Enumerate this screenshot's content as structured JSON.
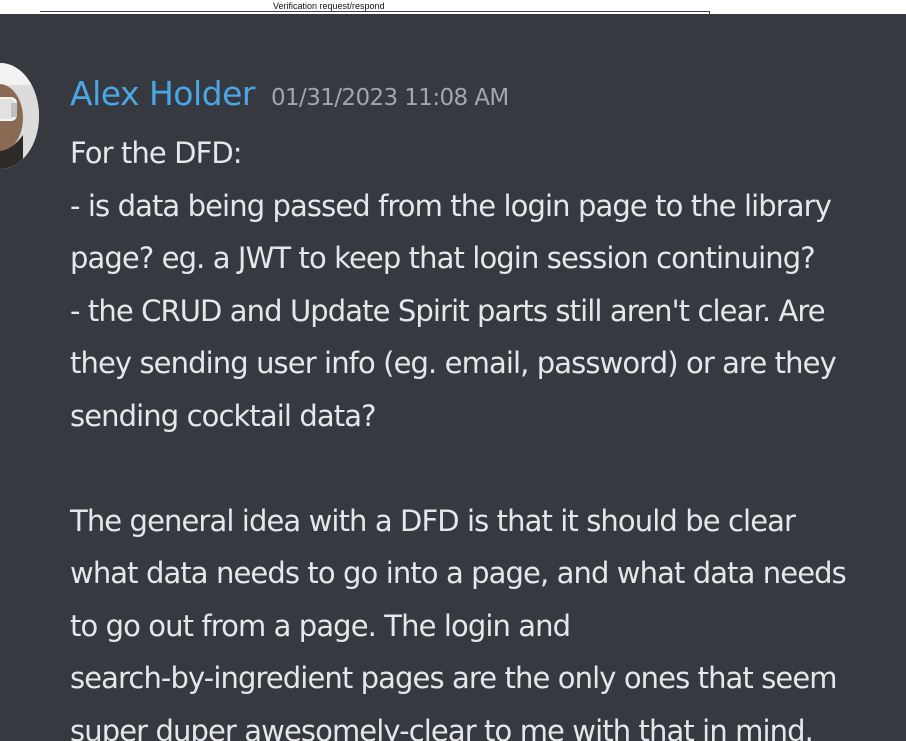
{
  "header_strip": {
    "caption": "Verification request/respond"
  },
  "message": {
    "author": "Alex Holder",
    "timestamp": "01/31/2023 11:08 AM",
    "lines": [
      "For the DFD:",
      "- is data being passed from the login page to the library",
      "page? eg. a JWT to keep that login session continuing?",
      "- the CRUD and Update Spirit parts still aren't clear. Are",
      "they sending user info (eg. email, password) or are they",
      "sending cocktail data?",
      "",
      "The general idea with a DFD is that it should be clear",
      "what data needs to go into a page, and what data needs",
      "to go out from a page. The login and",
      "search-by-ingredient pages are the only ones that seem",
      "super duper awesomely-clear to me with that in mind."
    ]
  },
  "colors": {
    "background": "#36393f",
    "username": "#4aa6e4",
    "timestamp": "#a3a6aa",
    "text": "#e6e7e9"
  },
  "icons": {
    "avatar": "user-avatar"
  }
}
